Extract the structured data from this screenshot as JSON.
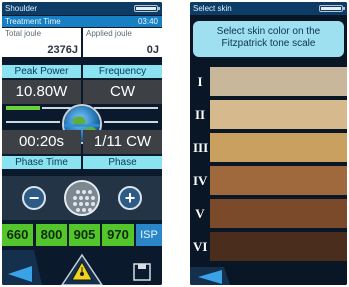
{
  "left_screen": {
    "status_bar": {
      "title": "Shoulder",
      "battery_icon": "battery-icon"
    },
    "treatment_time": {
      "label": "Treatment Time",
      "value": "03:40"
    },
    "total_joule": {
      "label": "Total joule",
      "value": "2376J"
    },
    "applied_joule": {
      "label": "Applied joule",
      "value": "0J"
    },
    "peak_power": {
      "label": "Peak Power",
      "value": "10.80W"
    },
    "frequency": {
      "label": "Frequency",
      "value": "CW"
    },
    "phase_time": {
      "label": "Phase Time",
      "value": "00:20s"
    },
    "phase": {
      "label": "Phase",
      "value": "1/11 CW"
    },
    "controls": {
      "minus": "−",
      "plus": "+"
    },
    "wavelengths": [
      "660",
      "800",
      "905",
      "970"
    ],
    "isp": "ISP",
    "icons": [
      "back-arrow-icon",
      "laser-warning-icon",
      "save-icon"
    ]
  },
  "right_screen": {
    "status_bar": {
      "title": "Select skin",
      "battery_icon": "battery-icon"
    },
    "banner_line1": "Select skin color on the",
    "banner_line2": "Fitzpatrick tone scale",
    "skin_types": [
      {
        "numeral": "I",
        "color": "#c9b79c"
      },
      {
        "numeral": "II",
        "color": "#d6b98c"
      },
      {
        "numeral": "III",
        "color": "#caa061"
      },
      {
        "numeral": "IV",
        "color": "#a0693d"
      },
      {
        "numeral": "V",
        "color": "#7a4a2b"
      },
      {
        "numeral": "VI",
        "color": "#4a2d1d"
      }
    ],
    "icons": [
      "back-arrow-icon"
    ]
  }
}
